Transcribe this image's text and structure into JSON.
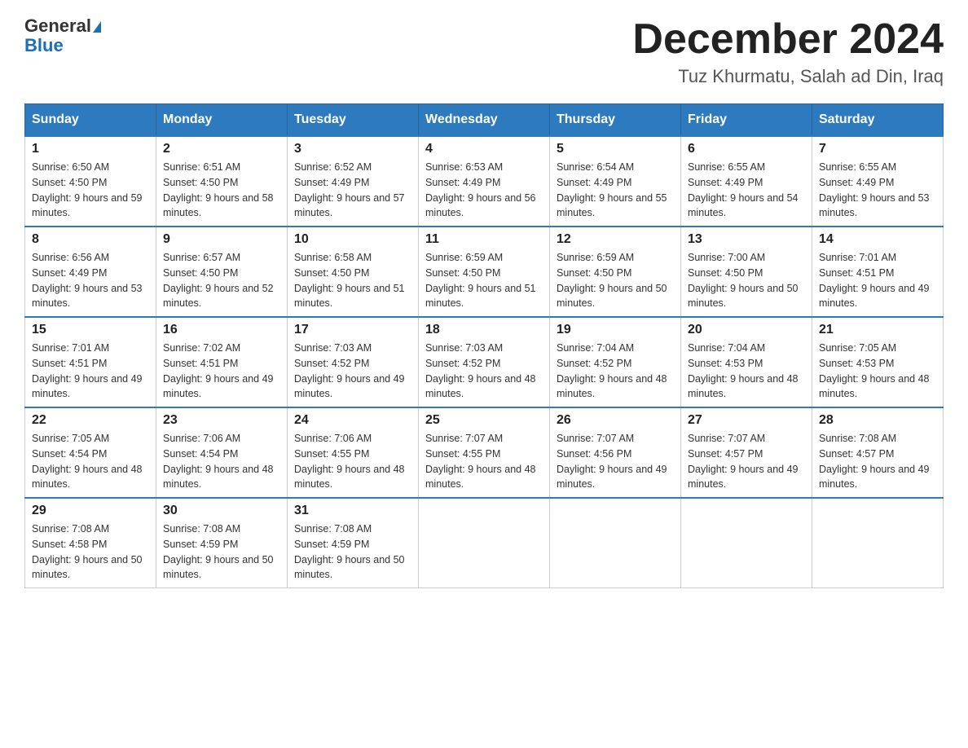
{
  "header": {
    "logo_general": "General",
    "logo_blue": "Blue",
    "month_title": "December 2024",
    "location": "Tuz Khurmatu, Salah ad Din, Iraq"
  },
  "days_of_week": [
    "Sunday",
    "Monday",
    "Tuesday",
    "Wednesday",
    "Thursday",
    "Friday",
    "Saturday"
  ],
  "weeks": [
    [
      {
        "day": "1",
        "sunrise": "6:50 AM",
        "sunset": "4:50 PM",
        "daylight": "9 hours and 59 minutes."
      },
      {
        "day": "2",
        "sunrise": "6:51 AM",
        "sunset": "4:50 PM",
        "daylight": "9 hours and 58 minutes."
      },
      {
        "day": "3",
        "sunrise": "6:52 AM",
        "sunset": "4:49 PM",
        "daylight": "9 hours and 57 minutes."
      },
      {
        "day": "4",
        "sunrise": "6:53 AM",
        "sunset": "4:49 PM",
        "daylight": "9 hours and 56 minutes."
      },
      {
        "day": "5",
        "sunrise": "6:54 AM",
        "sunset": "4:49 PM",
        "daylight": "9 hours and 55 minutes."
      },
      {
        "day": "6",
        "sunrise": "6:55 AM",
        "sunset": "4:49 PM",
        "daylight": "9 hours and 54 minutes."
      },
      {
        "day": "7",
        "sunrise": "6:55 AM",
        "sunset": "4:49 PM",
        "daylight": "9 hours and 53 minutes."
      }
    ],
    [
      {
        "day": "8",
        "sunrise": "6:56 AM",
        "sunset": "4:49 PM",
        "daylight": "9 hours and 53 minutes."
      },
      {
        "day": "9",
        "sunrise": "6:57 AM",
        "sunset": "4:50 PM",
        "daylight": "9 hours and 52 minutes."
      },
      {
        "day": "10",
        "sunrise": "6:58 AM",
        "sunset": "4:50 PM",
        "daylight": "9 hours and 51 minutes."
      },
      {
        "day": "11",
        "sunrise": "6:59 AM",
        "sunset": "4:50 PM",
        "daylight": "9 hours and 51 minutes."
      },
      {
        "day": "12",
        "sunrise": "6:59 AM",
        "sunset": "4:50 PM",
        "daylight": "9 hours and 50 minutes."
      },
      {
        "day": "13",
        "sunrise": "7:00 AM",
        "sunset": "4:50 PM",
        "daylight": "9 hours and 50 minutes."
      },
      {
        "day": "14",
        "sunrise": "7:01 AM",
        "sunset": "4:51 PM",
        "daylight": "9 hours and 49 minutes."
      }
    ],
    [
      {
        "day": "15",
        "sunrise": "7:01 AM",
        "sunset": "4:51 PM",
        "daylight": "9 hours and 49 minutes."
      },
      {
        "day": "16",
        "sunrise": "7:02 AM",
        "sunset": "4:51 PM",
        "daylight": "9 hours and 49 minutes."
      },
      {
        "day": "17",
        "sunrise": "7:03 AM",
        "sunset": "4:52 PM",
        "daylight": "9 hours and 49 minutes."
      },
      {
        "day": "18",
        "sunrise": "7:03 AM",
        "sunset": "4:52 PM",
        "daylight": "9 hours and 48 minutes."
      },
      {
        "day": "19",
        "sunrise": "7:04 AM",
        "sunset": "4:52 PM",
        "daylight": "9 hours and 48 minutes."
      },
      {
        "day": "20",
        "sunrise": "7:04 AM",
        "sunset": "4:53 PM",
        "daylight": "9 hours and 48 minutes."
      },
      {
        "day": "21",
        "sunrise": "7:05 AM",
        "sunset": "4:53 PM",
        "daylight": "9 hours and 48 minutes."
      }
    ],
    [
      {
        "day": "22",
        "sunrise": "7:05 AM",
        "sunset": "4:54 PM",
        "daylight": "9 hours and 48 minutes."
      },
      {
        "day": "23",
        "sunrise": "7:06 AM",
        "sunset": "4:54 PM",
        "daylight": "9 hours and 48 minutes."
      },
      {
        "day": "24",
        "sunrise": "7:06 AM",
        "sunset": "4:55 PM",
        "daylight": "9 hours and 48 minutes."
      },
      {
        "day": "25",
        "sunrise": "7:07 AM",
        "sunset": "4:55 PM",
        "daylight": "9 hours and 48 minutes."
      },
      {
        "day": "26",
        "sunrise": "7:07 AM",
        "sunset": "4:56 PM",
        "daylight": "9 hours and 49 minutes."
      },
      {
        "day": "27",
        "sunrise": "7:07 AM",
        "sunset": "4:57 PM",
        "daylight": "9 hours and 49 minutes."
      },
      {
        "day": "28",
        "sunrise": "7:08 AM",
        "sunset": "4:57 PM",
        "daylight": "9 hours and 49 minutes."
      }
    ],
    [
      {
        "day": "29",
        "sunrise": "7:08 AM",
        "sunset": "4:58 PM",
        "daylight": "9 hours and 50 minutes."
      },
      {
        "day": "30",
        "sunrise": "7:08 AM",
        "sunset": "4:59 PM",
        "daylight": "9 hours and 50 minutes."
      },
      {
        "day": "31",
        "sunrise": "7:08 AM",
        "sunset": "4:59 PM",
        "daylight": "9 hours and 50 minutes."
      },
      null,
      null,
      null,
      null
    ]
  ]
}
